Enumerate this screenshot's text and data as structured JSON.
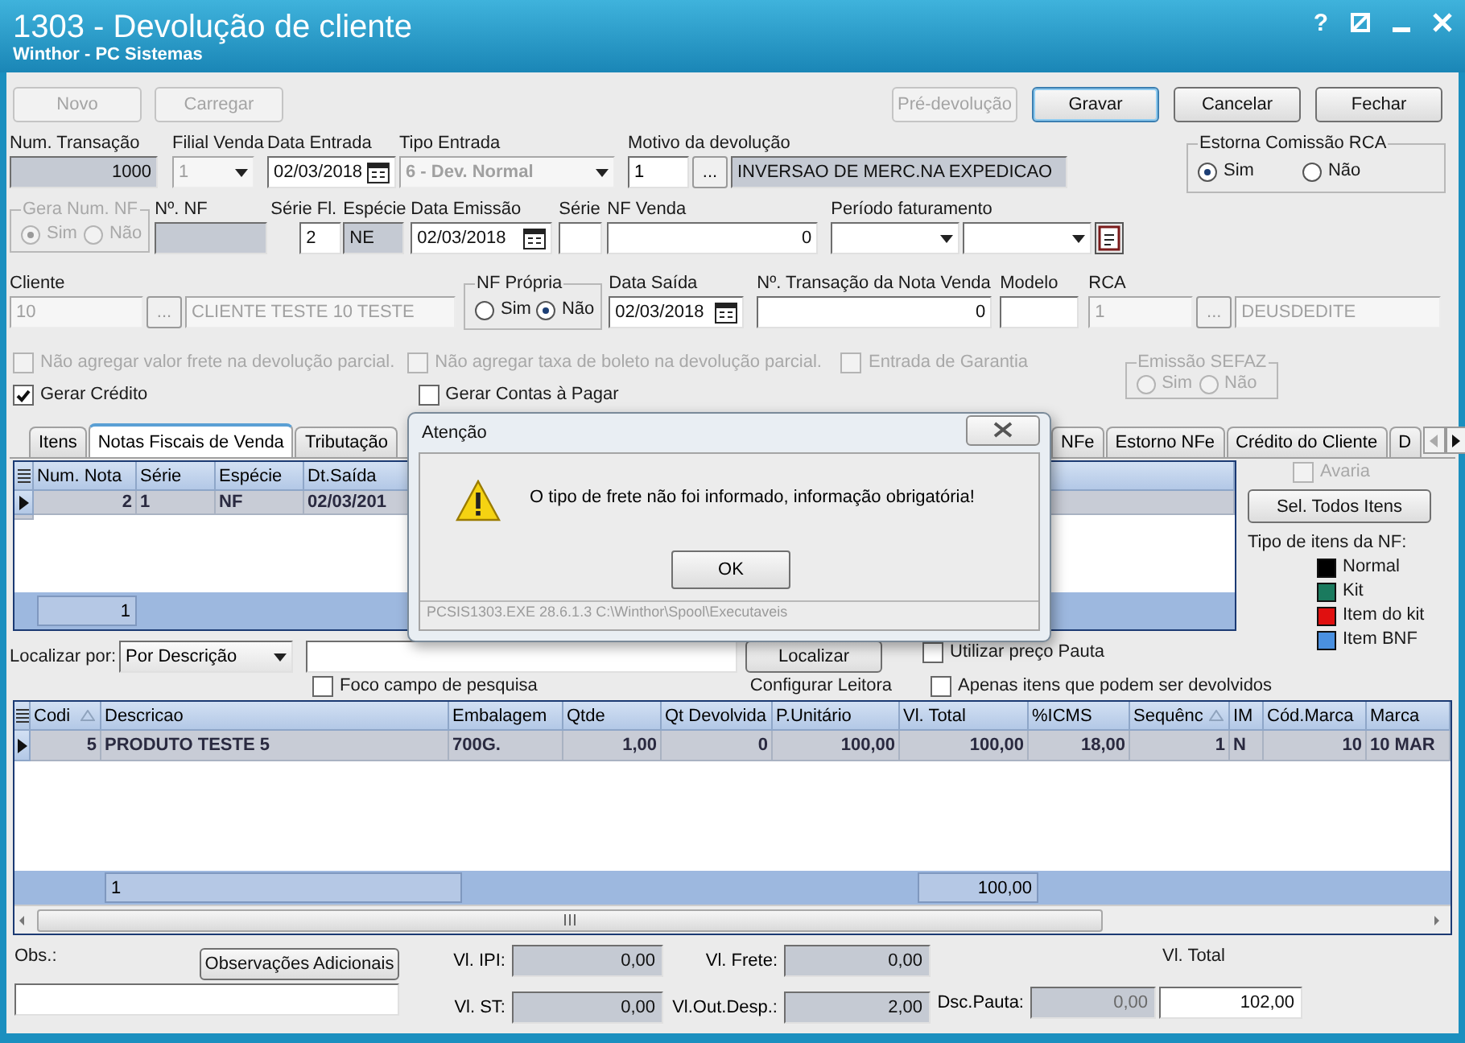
{
  "window": {
    "title": "1303 - Devolução de cliente",
    "subtitle": "Winthor - PC Sistemas",
    "help": "?"
  },
  "toolbar": {
    "left": [
      {
        "label": "Novo",
        "disabled": true,
        "focused": false
      },
      {
        "label": "Carregar",
        "disabled": true,
        "focused": false
      }
    ],
    "right": [
      {
        "label": "Pré-devolução",
        "disabled": true,
        "focused": false
      },
      {
        "label": "Gravar",
        "disabled": false,
        "focused": true
      },
      {
        "label": "Cancelar",
        "disabled": false,
        "focused": false
      },
      {
        "label": "Fechar",
        "disabled": false,
        "focused": false
      }
    ]
  },
  "row1": {
    "num_transacao": {
      "label": "Num. Transação",
      "value": "1000",
      "readonly": true,
      "disabled": false
    },
    "filial_venda": {
      "label": "Filial Venda",
      "value": "1",
      "readonly": false,
      "disabled": true
    },
    "data_entrada": {
      "label": "Data Entrada",
      "value": "02/03/2018",
      "readonly": false,
      "disabled": false
    },
    "tipo_entrada": {
      "label": "Tipo Entrada",
      "value": "6 - Dev. Normal",
      "readonly": false,
      "disabled": true
    },
    "motivo": {
      "label": "Motivo da devolução",
      "code": "1",
      "button": "...",
      "description": "INVERSAO DE MERC.NA EXPEDICAO",
      "readonly": true,
      "disabled": false
    },
    "estorna_comissao": {
      "label": "Estorna Comissão RCA",
      "disabled": false,
      "options": [
        {
          "label": "Sim",
          "selected": true
        },
        {
          "label": "Não",
          "selected": false
        }
      ]
    }
  },
  "row2": {
    "gera_num_nf": {
      "label": "Gera Num. NF",
      "disabled": true,
      "options": [
        {
          "label": "Sim",
          "selected": true
        },
        {
          "label": "Não",
          "selected": false
        }
      ]
    },
    "numero_nf": {
      "label": "Nº. NF",
      "readonly": true,
      "disabled": false
    },
    "serie_fl": {
      "label": "Série Fl.",
      "value": "2",
      "readonly": false,
      "disabled": false
    },
    "especie": {
      "label": "Espécie",
      "value": "NE",
      "readonly": true,
      "disabled": false
    },
    "data_emissao": {
      "label": "Data Emissão",
      "value": "02/03/2018",
      "readonly": false,
      "disabled": false
    },
    "serie": {
      "label": "Série",
      "readonly": false,
      "disabled": false
    },
    "nf_venda": {
      "label": "NF Venda",
      "value": "0",
      "readonly": false,
      "disabled": false
    },
    "periodo_faturamento": {
      "label": "Período faturamento"
    }
  },
  "row3": {
    "cliente": {
      "label": "Cliente",
      "code": "10",
      "button": "...",
      "name": "CLIENTE TESTE 10 TESTE",
      "readonly": false,
      "disabled": true
    },
    "nf_propria": {
      "label": "NF Própria",
      "disabled": false,
      "options": [
        {
          "label": "Sim",
          "selected": false
        },
        {
          "label": "Não",
          "selected": true
        }
      ]
    },
    "data_saida": {
      "label": "Data Saída",
      "value": "02/03/2018",
      "readonly": false,
      "disabled": false
    },
    "transacao_nota_venda": {
      "label": "Nº. Transação da Nota Venda",
      "value": "0",
      "readonly": false,
      "disabled": false
    },
    "modelo": {
      "label": "Modelo",
      "readonly": false,
      "disabled": false
    },
    "rca": {
      "label": "RCA",
      "code": "1",
      "button": "...",
      "name": "DEUSDEDITE",
      "readonly": false,
      "disabled": true
    }
  },
  "flags": [
    {
      "label": "Não agregar valor frete na devolução parcial.",
      "checked": false,
      "disabled": true
    },
    {
      "label": "Não agregar taxa de boleto na devolução parcial.",
      "checked": false,
      "disabled": true
    },
    {
      "label": "Entrada de Garantia",
      "checked": false,
      "disabled": true
    }
  ],
  "emissao_sefaz": {
    "label": "Emissão SEFAZ",
    "disabled": true,
    "options": [
      {
        "label": "Sim",
        "selected": false
      },
      {
        "label": "Não",
        "selected": false
      }
    ]
  },
  "flags_2": [
    {
      "label": "Gerar Crédito",
      "checked": true,
      "disabled": false
    },
    {
      "label": "Gerar Contas à Pagar",
      "checked": false,
      "disabled": false
    }
  ],
  "tabs": [
    {
      "label": "Itens",
      "selected": false
    },
    {
      "label": "Notas Fiscais de Venda",
      "selected": true
    },
    {
      "label": "Tributação",
      "selected": false
    },
    {
      "label": "NFe",
      "selected": false
    },
    {
      "label": "Estorno NFe",
      "selected": false
    },
    {
      "label": "Crédito do Cliente",
      "selected": false
    },
    {
      "label": "D",
      "selected": false
    }
  ],
  "nf_grid": {
    "columns": [
      "Num. Nota",
      "Série",
      "Espécie",
      "Dt.Saída"
    ],
    "rows": [
      {
        "cells": [
          "2",
          "1",
          "NF",
          "02/03/201"
        ],
        "selected": true
      }
    ],
    "footer": "1"
  },
  "side_panel": {
    "avaria": {
      "label": "Avaria",
      "checked": false,
      "disabled": true
    },
    "select_all": "Sel. Todos Itens",
    "legend_title": "Tipo de itens da NF:",
    "legend": [
      {
        "label": "Normal",
        "color": "#000000"
      },
      {
        "label": "Kit",
        "color": "#1a7a5e"
      },
      {
        "label": "Item do kit",
        "color": "#e01010"
      },
      {
        "label": "Item BNF",
        "color": "#4a90e0"
      }
    ]
  },
  "search": {
    "label": "Localizar por:",
    "mode": "Por Descrição",
    "button": "Localizar",
    "reader": "Configurar Leitora",
    "focus": {
      "label": "Foco campo de pesquisa",
      "checked": false,
      "disabled": false
    },
    "pauta": {
      "label": "Utilizar preço Pauta",
      "checked": false,
      "disabled": false
    },
    "only_returnable": {
      "label": "Apenas itens que podem ser devolvidos",
      "checked": false,
      "disabled": false
    }
  },
  "items_grid": {
    "columns": [
      {
        "label": "Codi",
        "sorted": true
      },
      {
        "label": "Descricao",
        "sorted": false
      },
      {
        "label": "Embalagem",
        "sorted": false
      },
      {
        "label": "Qtde",
        "sorted": false
      },
      {
        "label": "Qt Devolvida",
        "sorted": false
      },
      {
        "label": "P.Unitário",
        "sorted": false
      },
      {
        "label": "Vl. Total",
        "sorted": false
      },
      {
        "label": "%ICMS",
        "sorted": false
      },
      {
        "label": "Sequênc",
        "sorted": true
      },
      {
        "label": "IM",
        "sorted": false
      },
      {
        "label": "Cód.Marca",
        "sorted": false
      },
      {
        "label": "Marca",
        "sorted": false
      }
    ],
    "rows": [
      {
        "cells": [
          "5",
          "PRODUTO TESTE 5",
          "700G.",
          "1,00",
          "0",
          "100,00",
          "100,00",
          "18,00",
          "1",
          "N",
          "10",
          "10 MAR"
        ],
        "selected": true
      }
    ],
    "footer": {
      "count": "1",
      "total": "100,00"
    }
  },
  "totals": {
    "obs_label": "Obs.:",
    "obs_button": "Observações Adicionais",
    "ipi": {
      "label": "Vl. IPI:",
      "value": "0,00"
    },
    "st": {
      "label": "Vl. ST:",
      "value": "0,00"
    },
    "frete": {
      "label": "Vl. Frete:",
      "value": "0,00"
    },
    "outras": {
      "label": "Vl.Out.Desp.:",
      "value": "2,00"
    },
    "pauta": {
      "label": "Dsc.Pauta:",
      "value": "0,00",
      "disabled": true
    },
    "total": {
      "label": "Vl. Total",
      "value": "102,00"
    }
  },
  "dialog": {
    "title": "Atenção",
    "message": "O tipo de frete não foi informado, informação obrigatória!",
    "button": "OK",
    "status": "PCSIS1303.EXE 28.6.1.3 C:\\Winthor\\Spool\\Executaveis"
  }
}
